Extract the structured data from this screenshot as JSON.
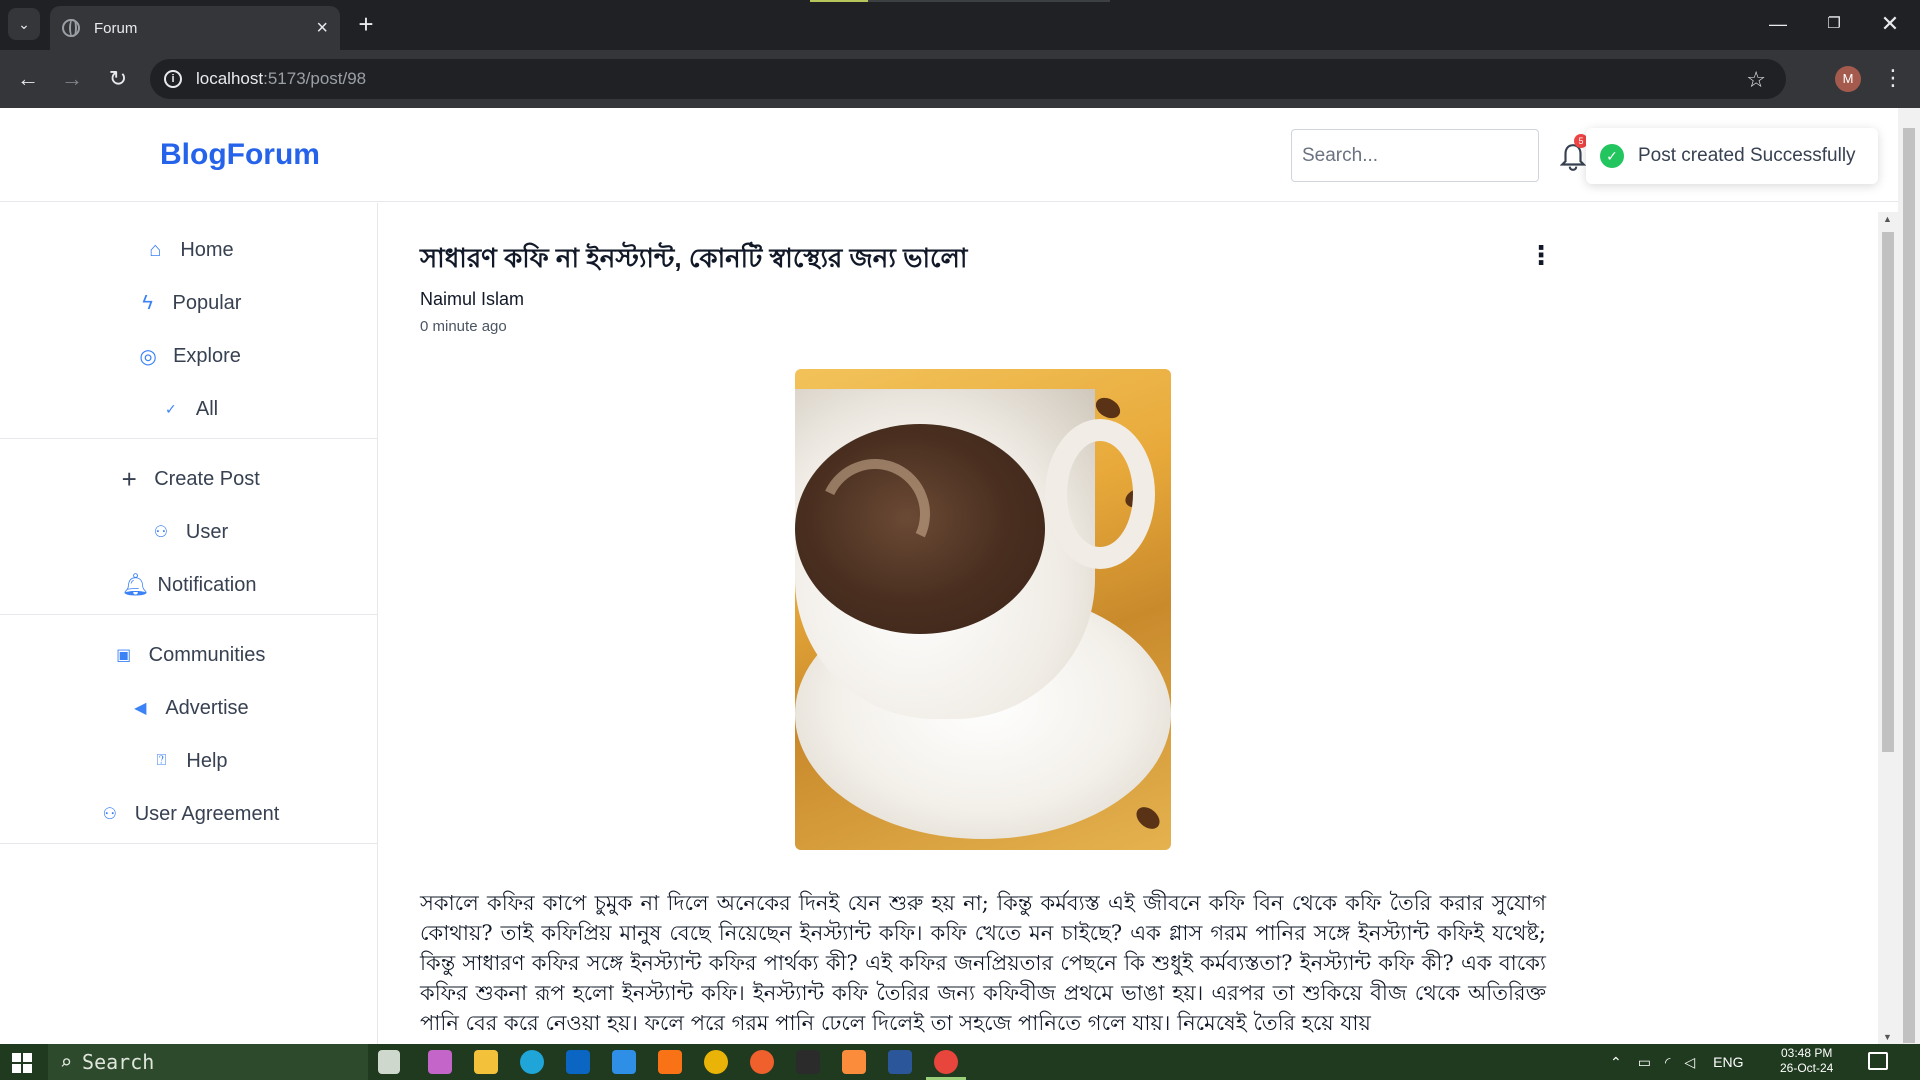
{
  "browser": {
    "tab_title": "Forum",
    "url_host": "localhost",
    "url_path": ":5173/post/98",
    "profile_initial": "M"
  },
  "site": {
    "logo": "BlogForum",
    "search_placeholder": "Search...",
    "notification_badge": "5",
    "toast_message": "Post created Successfully"
  },
  "sidebar": {
    "items": [
      {
        "label": "Home",
        "icon": "home-icon"
      },
      {
        "label": "Popular",
        "icon": "bolt-icon"
      },
      {
        "label": "Explore",
        "icon": "compass-icon"
      },
      {
        "label": "All",
        "icon": "check-icon"
      },
      {
        "label": "Create Post",
        "icon": "plus-icon"
      },
      {
        "label": "User",
        "icon": "user-icon"
      },
      {
        "label": "Notification",
        "icon": "bell-icon"
      },
      {
        "label": "Communities",
        "icon": "communities-icon"
      },
      {
        "label": "Advertise",
        "icon": "megaphone-icon"
      },
      {
        "label": "Help",
        "icon": "help-icon"
      },
      {
        "label": "User Agreement",
        "icon": "user-agreement-icon"
      }
    ]
  },
  "post": {
    "title": "সাধারণ কফি না ইনস্ট্যান্ট, কোনটি স্বাস্থ্যের জন্য ভালো",
    "author": "Naimul Islam",
    "time": "0 minute ago",
    "image_alt": "coffee-cup-image",
    "body": "সকালে কফির কাপে চুমুক না দিলে অনেকের দিনই যেন শুরু হয় না; কিন্তু কর্মব্যস্ত এই জীবনে কফি বিন থেকে কফি তৈরি করার সুযোগ কোথায়? তাই কফিপ্রিয় মানুষ বেছে নিয়েছেন ইনস্ট্যান্ট কফি। কফি খেতে মন চাইছে? এক গ্লাস গরম পানির সঙ্গে ইনস্ট্যান্ট কফিই যথেষ্ট; কিন্তু সাধারণ কফির সঙ্গে ইনস্ট্যান্ট কফির পার্থক্য কী? এই কফির জনপ্রিয়তার পেছনে কি শুধুই কর্মব্যস্ততা? ইনস্ট্যান্ট কফি কী? এক বাক্যে কফির শুকনা রূপ হলো ইনস্ট্যান্ট কফি। ইনস্ট্যান্ট কফি তৈরির জন্য কফিবীজ প্রথমে ভাঙা হয়। এরপর তা শুকিয়ে বীজ থেকে অতিরিক্ত পানি বের করে নেওয়া হয়। ফলে পরে গরম পানি ঢেলে দিলেই তা সহজে পানিতে গলে যায়। নিমেষেই তৈরি হয়ে যায়"
  },
  "taskbar": {
    "search_label": "Search",
    "language": "ENG",
    "time": "03:48 PM",
    "date": "26-Oct-24"
  },
  "colors": {
    "brand": "#2563eb",
    "toast_success": "#22c55e",
    "sidebar_icon": "#3b82f6"
  }
}
